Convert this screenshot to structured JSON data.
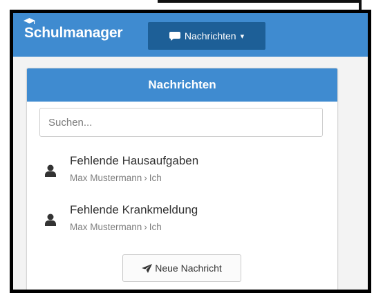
{
  "navbar": {
    "brand": "Schulmanager",
    "messages_button": {
      "label": "Nachrichten",
      "icon": "chat-bubble-icon",
      "caret": "▾"
    }
  },
  "panel": {
    "title": "Nachrichten",
    "search": {
      "placeholder": "Suchen...",
      "value": ""
    },
    "messages": [
      {
        "subject": "Fehlende Hausaufgaben",
        "from": "Max Mustermann",
        "separator": "›",
        "to": "Ich"
      },
      {
        "subject": "Fehlende Krankmeldung",
        "from": "Max Mustermann",
        "separator": "›",
        "to": "Ich"
      }
    ],
    "new_message_button": {
      "label": "Neue Nachricht",
      "icon": "paper-plane-icon"
    }
  },
  "colors": {
    "primary": "#3f8bd0",
    "primary_dark": "#1d5f97",
    "frame": "#000000"
  }
}
